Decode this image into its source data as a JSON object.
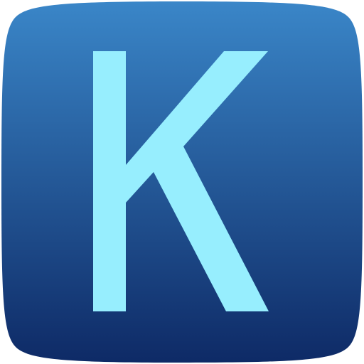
{
  "app_icon": {
    "letter": "K",
    "colors": {
      "gradient_top": "#3A86C8",
      "gradient_bottom": "#0E2A66",
      "letter": "#97EEFE"
    }
  }
}
